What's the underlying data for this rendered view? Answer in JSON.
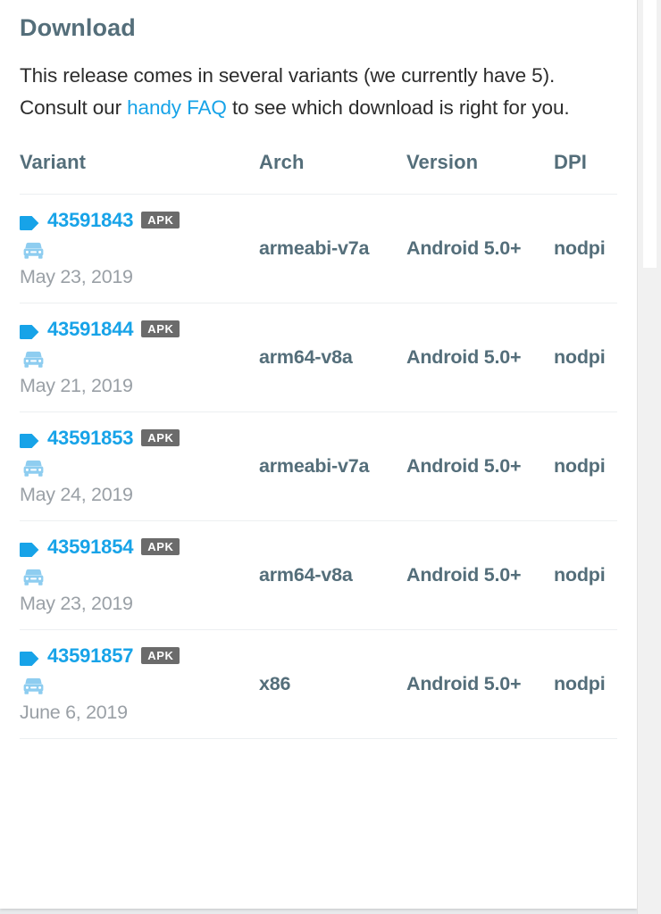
{
  "section": {
    "title": "Download",
    "intro_prefix": "This release comes in several variants (we currently have 5). Consult our ",
    "intro_link": "handy FAQ",
    "intro_suffix": " to see which download is right for you."
  },
  "colors": {
    "heading": "#546e7a",
    "link": "#17a3e8",
    "tag_icon": "#17a3e8",
    "car_icon": "#8ecdf0",
    "badge_bg": "#6b6b6b",
    "body_text": "#2c2c2c",
    "date_text": "#9aa0a6",
    "row_border": "#eceff1",
    "card_bg": "#ffffff",
    "page_bg": "#e8eaec"
  },
  "table": {
    "columns": [
      "Variant",
      "Arch",
      "Version",
      "DPI"
    ],
    "rows": [
      {
        "variant_icon": "tag-icon",
        "variant_code": "43591843",
        "badge": "APK",
        "feature_icon": "car-icon",
        "date": "May 23, 2019",
        "arch": "armeabi-v7a",
        "version": "Android 5.0+",
        "dpi": "nodpi"
      },
      {
        "variant_icon": "tag-icon",
        "variant_code": "43591844",
        "badge": "APK",
        "feature_icon": "car-icon",
        "date": "May 21, 2019",
        "arch": "arm64-v8a",
        "version": "Android 5.0+",
        "dpi": "nodpi"
      },
      {
        "variant_icon": "tag-icon",
        "variant_code": "43591853",
        "badge": "APK",
        "feature_icon": "car-icon",
        "date": "May 24, 2019",
        "arch": "armeabi-v7a",
        "version": "Android 5.0+",
        "dpi": "nodpi"
      },
      {
        "variant_icon": "tag-icon",
        "variant_code": "43591854",
        "badge": "APK",
        "feature_icon": "car-icon",
        "date": "May 23, 2019",
        "arch": "arm64-v8a",
        "version": "Android 5.0+",
        "dpi": "nodpi"
      },
      {
        "variant_icon": "tag-icon",
        "variant_code": "43591857",
        "badge": "APK",
        "feature_icon": "car-icon",
        "date": "June 6, 2019",
        "arch": "x86",
        "version": "Android 5.0+",
        "dpi": "nodpi"
      }
    ]
  }
}
